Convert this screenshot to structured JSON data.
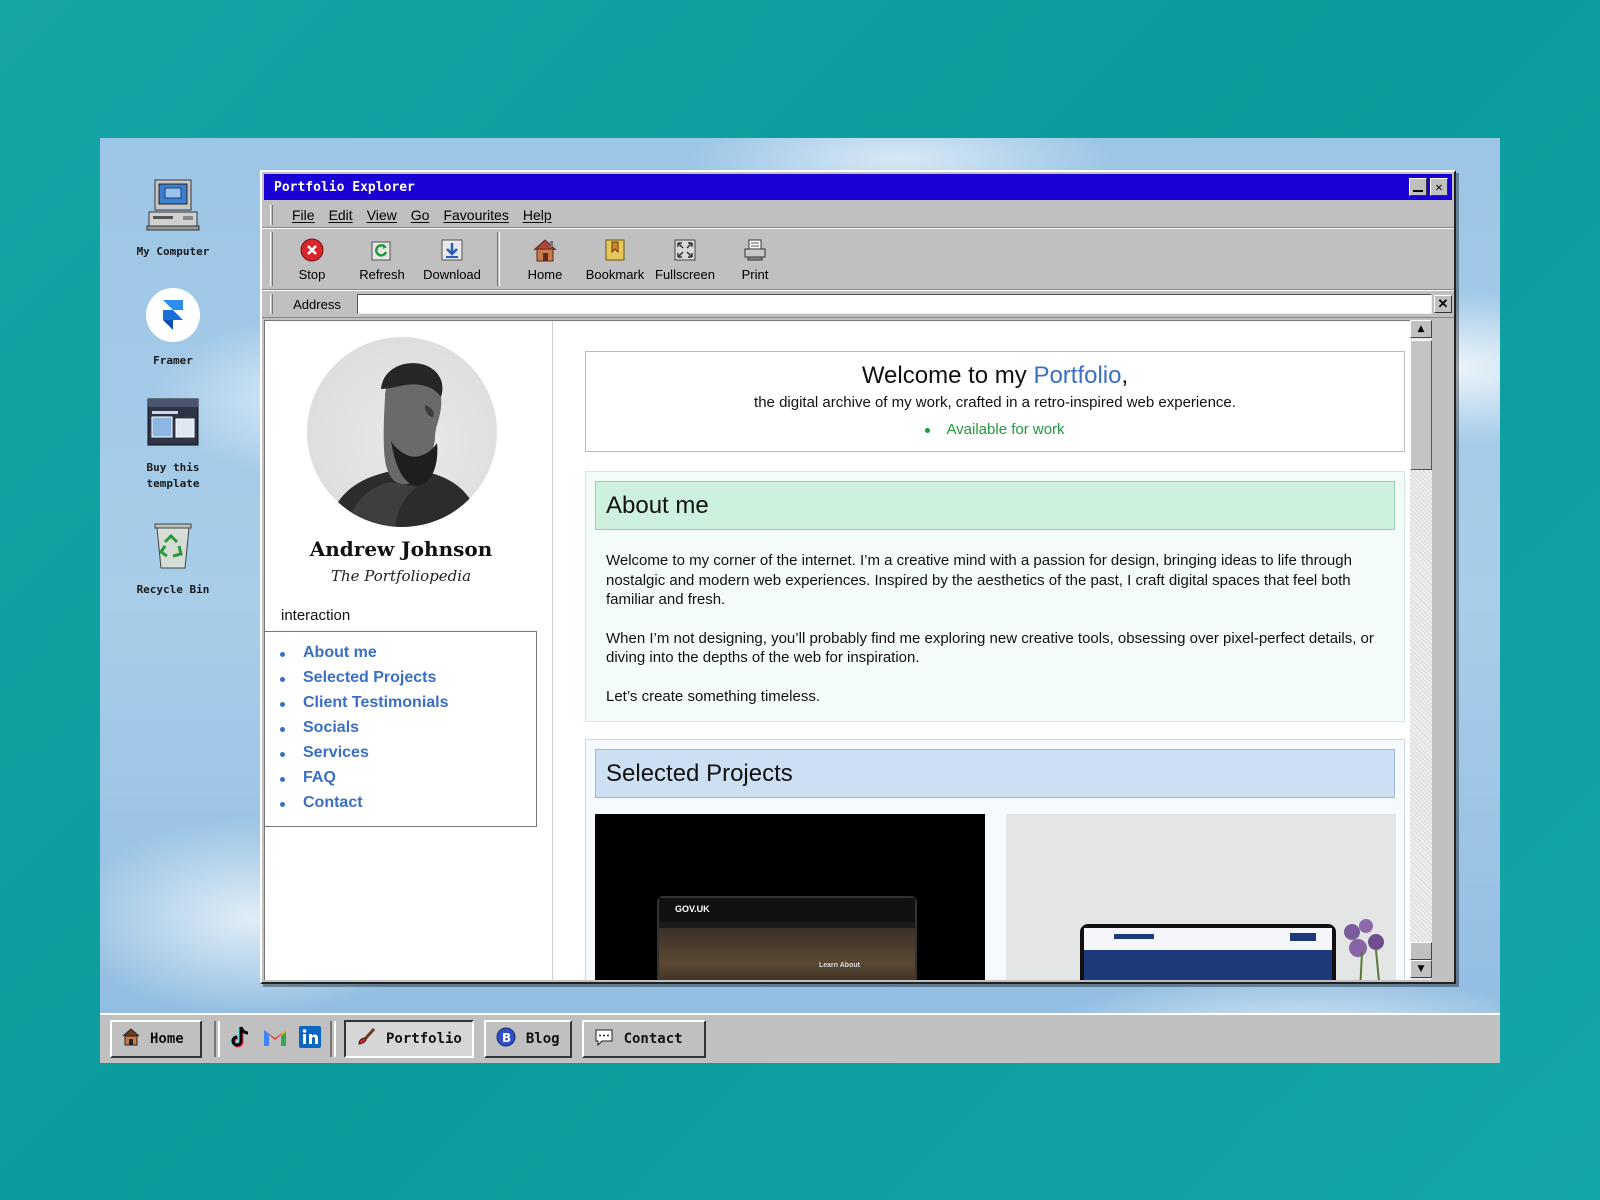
{
  "desktop": {
    "icons": [
      {
        "label": "My Computer",
        "icon": "computer-icon"
      },
      {
        "label": "Framer",
        "icon": "framer-icon"
      },
      {
        "label": "Buy this template",
        "icon": "template-icon"
      },
      {
        "label": "Recycle Bin",
        "icon": "recycle-bin-icon"
      }
    ]
  },
  "window": {
    "title": "Portfolio Explorer",
    "menu": [
      "File",
      "Edit",
      "View",
      "Go",
      "Favourites",
      "Help"
    ],
    "toolbar": {
      "stop": "Stop",
      "refresh": "Refresh",
      "download": "Download",
      "home": "Home",
      "bookmark": "Bookmark",
      "fullscreen": "Fullscreen",
      "print": "Print"
    },
    "address_label": "Address",
    "address_value": ""
  },
  "sidebar": {
    "name": "Andrew Johnson",
    "subtitle": "The Portfoliopedia",
    "nav_heading": "interaction",
    "nav": [
      "About me",
      "Selected Projects",
      "Client Testimonials",
      "Socials",
      "Services",
      "FAQ",
      "Contact"
    ]
  },
  "main": {
    "welcome": {
      "prefix": "Welcome to my ",
      "accent": "Portfolio",
      "suffix": ",",
      "subtitle": "the digital archive of my work, crafted in a retro-inspired web experience.",
      "status": "Available for work"
    },
    "about": {
      "heading": "About me",
      "paragraphs": [
        "Welcome to my corner of the internet. I’m a creative mind with a passion for design, bringing ideas to life through nostalgic and modern web experiences. Inspired by the aesthetics of the past, I craft digital spaces that feel both familiar and fresh.",
        "When I’m not designing, you’ll probably find me exploring new creative tools, obsessing over pixel-perfect details, or diving into the depths of the web for inspiration.",
        "Let’s create something timeless."
      ]
    },
    "projects": {
      "heading": "Selected Projects",
      "thumb_a_label": "GOV.UK",
      "thumb_a_caption": "Learn About"
    }
  },
  "taskbar": {
    "home": "Home",
    "quick_links": [
      "tiktok-icon",
      "gmail-icon",
      "linkedin-icon"
    ],
    "portfolio": "Portfolio",
    "blog": "Blog",
    "contact": "Contact"
  },
  "colors": {
    "titlebar": "#1a00d4",
    "link": "#3a6fc4",
    "status_green": "#1f9a3a",
    "about_header": "#cdf1dd",
    "projects_header": "#cddff3"
  }
}
